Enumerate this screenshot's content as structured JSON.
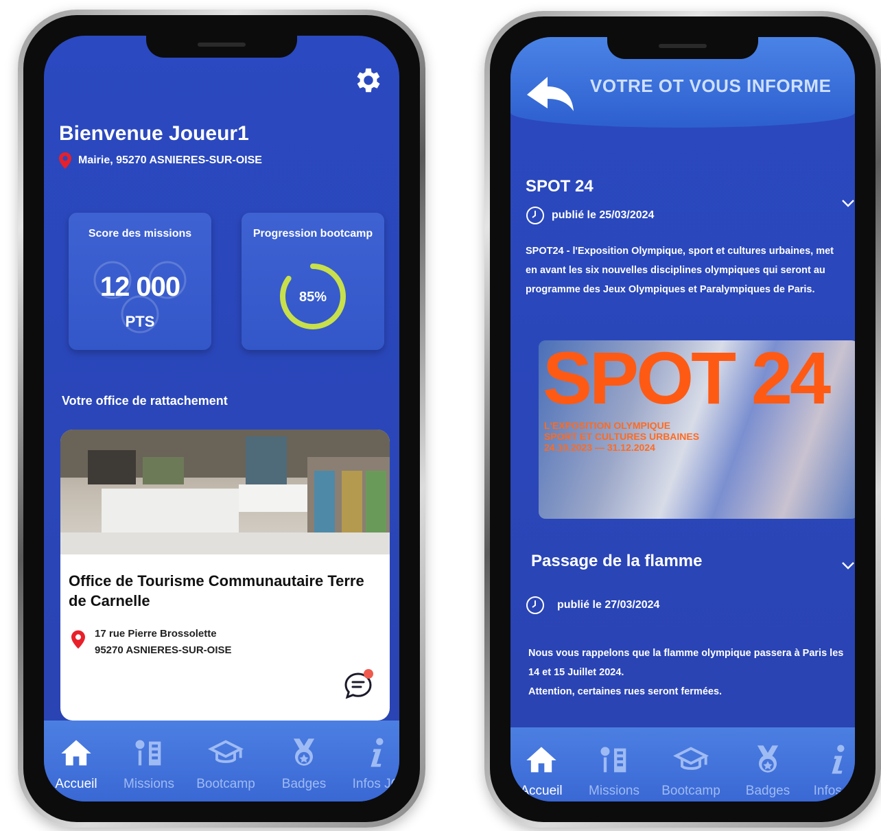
{
  "home": {
    "welcome": "Bienvenue Joueur1",
    "location": "Mairie, 95270 ASNIERES-SUR-OISE",
    "score_card": {
      "title": "Score des missions",
      "value": "12 000",
      "unit": "PTS"
    },
    "progress_card": {
      "title": "Progression bootcamp",
      "label": "85%",
      "value": 0.85
    },
    "office_section": "Votre office de rattachement",
    "office": {
      "name": "Office de Tourisme Communautaire Terre de Carnelle",
      "address_line1": "17 rue Pierre Brossolette",
      "address_line2": "95270 ASNIERES-SUR-OISE"
    }
  },
  "news": {
    "header_title": "VOTRE OT VOUS INFORME",
    "items": [
      {
        "title": "SPOT 24",
        "date": "publié le 25/03/2024",
        "body": "SPOT24 - l'Exposition Olympique, sport et cultures urbaines, met en avant les six nouvelles disciplines olympiques qui seront au programme des Jeux Olympiques et Paralympiques de Paris."
      },
      {
        "title": "Passage de la flamme",
        "date": "publié le 27/03/2024",
        "body_line1": "Nous vous rappelons que la flamme olympique passera à Paris les 14 et 15 Juillet 2024.",
        "body_line2": "Attention, certaines rues seront fermées."
      }
    ],
    "poster": {
      "big": "SPOT 24",
      "line1": "L'EXPOSITION OLYMPIQUE",
      "line2": "SPORT ET CULTURES URBAINES",
      "line3": "24.10.2023 — 31.12.2024"
    }
  },
  "tabs": [
    {
      "label": "Accueil",
      "icon": "home-icon"
    },
    {
      "label": "Missions",
      "icon": "missions-icon"
    },
    {
      "label": "Bootcamp",
      "icon": "graduation-cap-icon"
    },
    {
      "label": "Badges",
      "icon": "medal-icon"
    },
    {
      "label": "Infos JO",
      "icon": "info-icon"
    }
  ],
  "colors": {
    "primary": "#2b49c0",
    "tab_bar": "#4c7fe2",
    "accent": "#c8e04a",
    "pin": "#e8202a",
    "poster": "#ff5a14"
  }
}
